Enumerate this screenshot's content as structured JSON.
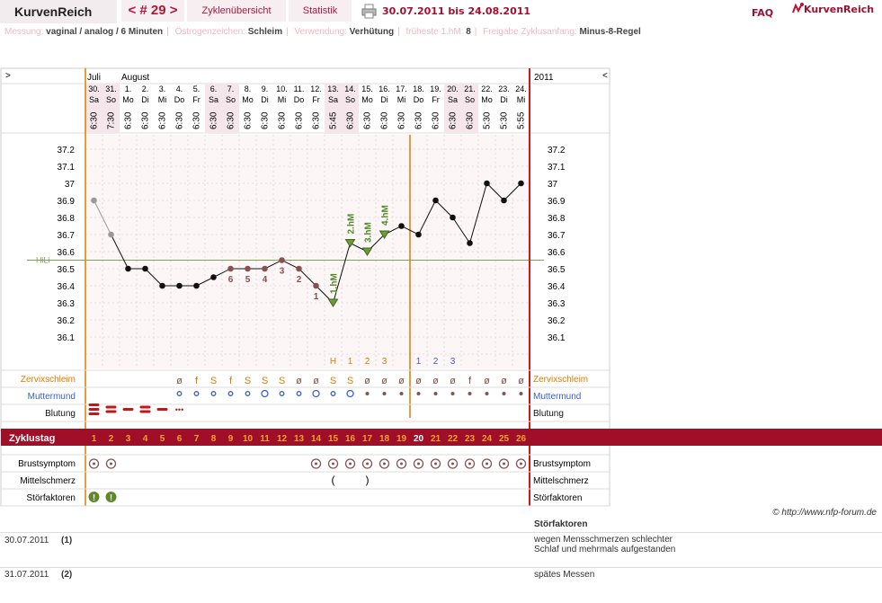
{
  "header": {
    "brand": "KurvenReich",
    "cycle_nav": "< # 29 >",
    "overview_label": "Zyklenübersicht",
    "stats_label": "Statistik",
    "date_range": "30.07.2011 bis 24.08.2011",
    "faq_label": "FAQ",
    "logo_text": "KurvenReich"
  },
  "info": [
    {
      "label": "Messung:",
      "value": "vaginal / analog / 6 Minuten"
    },
    {
      "label": "Östrogenzeichen:",
      "value": "Schleim"
    },
    {
      "label": "Verwendung:",
      "value": "Verhütung"
    },
    {
      "label": "früheste 1.hM:",
      "value": "8"
    },
    {
      "label": "Freigabe Zyklusanfang:",
      "value": "Minus-8-Regel"
    }
  ],
  "chart_data": {
    "type": "line",
    "year": "2011",
    "months": [
      "Juli",
      "August"
    ],
    "nav_left": ">",
    "nav_right": "<",
    "dates": [
      "30.",
      "31.",
      "1.",
      "2.",
      "3.",
      "4.",
      "5.",
      "6.",
      "7.",
      "8.",
      "9.",
      "10.",
      "11.",
      "12.",
      "13.",
      "14.",
      "15.",
      "16.",
      "17.",
      "18.",
      "19.",
      "20.",
      "21.",
      "22.",
      "23.",
      "24."
    ],
    "weekdays": [
      "Sa",
      "So",
      "Mo",
      "Di",
      "Mi",
      "Do",
      "Fr",
      "Sa",
      "So",
      "Mo",
      "Di",
      "Mi",
      "Do",
      "Fr",
      "Sa",
      "So",
      "Mo",
      "Di",
      "Mi",
      "Do",
      "Fr",
      "Sa",
      "So",
      "Mo",
      "Di",
      "Mi"
    ],
    "times": [
      "6:30",
      "7:30",
      "6:30",
      "6:30",
      "6:30",
      "6:30",
      "6:30",
      "6:30",
      "6:30",
      "6:30",
      "6:30",
      "6:30",
      "6:30",
      "6:30",
      "5:45",
      "6:30",
      "6:30",
      "6:30",
      "6:30",
      "6:30",
      "6:30",
      "6:30",
      "6:30",
      "5:30",
      "5:30",
      "5:55"
    ],
    "weekend": [
      true,
      true,
      false,
      false,
      false,
      false,
      false,
      true,
      true,
      false,
      false,
      false,
      false,
      false,
      true,
      true,
      false,
      false,
      false,
      false,
      false,
      true,
      true,
      false,
      false,
      false
    ],
    "temperatures": [
      36.9,
      36.7,
      36.5,
      36.5,
      36.4,
      36.4,
      36.4,
      36.45,
      36.5,
      36.5,
      36.5,
      36.55,
      36.5,
      36.4,
      36.3,
      36.65,
      36.6,
      36.7,
      36.75,
      36.7,
      36.9,
      36.8,
      36.65,
      37.0,
      36.9,
      37.0
    ],
    "excluded_days": [
      1,
      2
    ],
    "yticks": [
      "37.2",
      "37.1",
      "37",
      "36.9",
      "36.8",
      "36.7",
      "36.6",
      "36.5",
      "36.4",
      "36.3",
      "36.2",
      "36.1"
    ],
    "ylim": [
      36.1,
      37.2
    ],
    "cover_line": {
      "label": "HiLi",
      "value": 36.55
    },
    "low_labels": [
      {
        "day": 9,
        "text": "6"
      },
      {
        "day": 10,
        "text": "5"
      },
      {
        "day": 11,
        "text": "4"
      },
      {
        "day": 12,
        "text": "3"
      },
      {
        "day": 13,
        "text": "2"
      },
      {
        "day": 14,
        "text": "1"
      }
    ],
    "high_labels": [
      {
        "day": 15,
        "text": "1.hM"
      },
      {
        "day": 16,
        "text": "2.hM"
      },
      {
        "day": 17,
        "text": "3.hM"
      },
      {
        "day": 18,
        "text": "4.hM"
      }
    ],
    "peak_labels": [
      {
        "day": 15,
        "text": "H"
      },
      {
        "day": 16,
        "text": "1"
      },
      {
        "day": 17,
        "text": "2"
      },
      {
        "day": 18,
        "text": "3"
      }
    ],
    "post_labels": [
      {
        "day": 20,
        "text": "1"
      },
      {
        "day": 21,
        "text": "2"
      },
      {
        "day": 22,
        "text": "3"
      }
    ],
    "cervical_mucus": [
      "",
      "",
      "",
      "",
      "",
      "ø",
      "f",
      "S",
      "f",
      "S",
      "S",
      "S",
      "ø",
      "ø",
      "S",
      "S",
      "ø",
      "ø",
      "ø",
      "ø",
      "ø",
      "ø",
      "f",
      "ø",
      "ø",
      "ø"
    ],
    "cycle_days": [
      "1",
      "2",
      "3",
      "4",
      "5",
      "6",
      "7",
      "8",
      "9",
      "10",
      "11",
      "12",
      "13",
      "14",
      "15",
      "16",
      "17",
      "18",
      "19",
      "20",
      "21",
      "22",
      "23",
      "24",
      "25",
      "26"
    ],
    "row_labels": {
      "mucus": "Zervixschleim",
      "cervix": "Muttermund",
      "bleeding": "Blutung",
      "cycle_day": "Zyklustag",
      "breast": "Brustsymptom",
      "midpain": "Mittelschmerz",
      "disturbance": "Störfaktoren"
    }
  },
  "notes": {
    "copyright": "© http://www.nfp-forum.de",
    "header": "Störfaktoren",
    "rows": [
      {
        "date": "30.07.2011",
        "ref": "(1)",
        "text": "wegen Mensschmerzen schlechter Schlaf und mehrmals aufgestanden"
      },
      {
        "date": "31.07.2011",
        "ref": "(2)",
        "text": "spätes Messen"
      }
    ]
  },
  "colors": {
    "accent": "#a01030",
    "orange": "#e07b00",
    "blue": "#3a5fc8",
    "green": "#4f8a2a",
    "cycle_bar": "#a00f28"
  }
}
